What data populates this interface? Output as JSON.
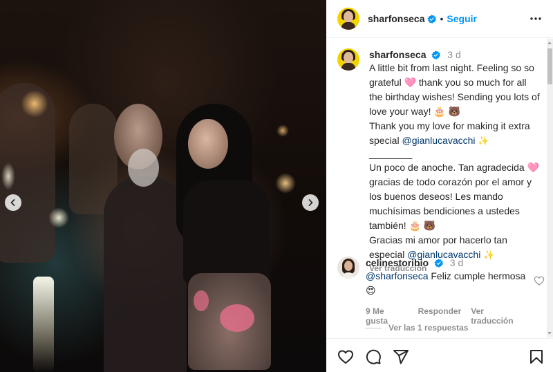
{
  "post": {
    "username": "sharfonseca",
    "follow_label": "Seguir",
    "verified": true,
    "accent_color": "#0095f6"
  },
  "caption": {
    "username": "sharfonseca",
    "time": "3 d",
    "lines": [
      "A little bit from last night. Feeling so so grateful 🩷 thank you so much for all the birthday wishes! Sending you lots of love your way! 🎂 🐻",
      "Thank you my love for making it extra special",
      "@gianlucavacchi",
      "✨",
      "________",
      "Un poco de anoche. Tan agradecida 🩷 gracias de todo corazón por el amor y los buenos deseos! Les mando muchísimas bendiciones a ustedes también! 🎂 🐻",
      "Gracias mi amor por hacerlo tan especial",
      "@gianlucavacchi",
      "✨"
    ],
    "see_translation": "Ver traducción"
  },
  "comment": {
    "username": "celinestoribio",
    "time": "3 d",
    "mention": "@sharfonseca",
    "text": "Feliz cumple hermosa 😍",
    "likes": "9 Me gusta",
    "reply": "Responder",
    "see_translation": "Ver traducción",
    "replies_label": "Ver las 1 respuestas"
  },
  "icons": {
    "like": "heart-icon",
    "comment": "comment-icon",
    "share": "share-icon",
    "save": "bookmark-icon",
    "more": "more-icon",
    "prev": "chevron-left-icon",
    "next": "chevron-right-icon"
  }
}
